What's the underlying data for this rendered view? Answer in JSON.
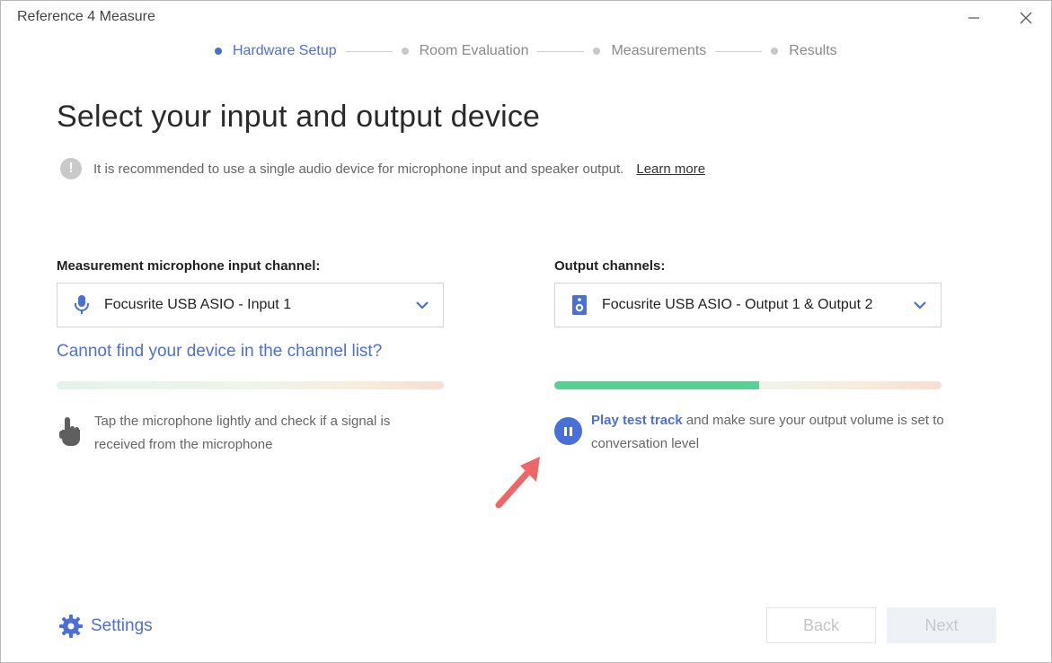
{
  "window": {
    "title": "Reference 4 Measure"
  },
  "stepper": {
    "steps": [
      {
        "label": "Hardware Setup",
        "active": true
      },
      {
        "label": "Room Evaluation",
        "active": false
      },
      {
        "label": "Measurements",
        "active": false
      },
      {
        "label": "Results",
        "active": false
      }
    ]
  },
  "page": {
    "title": "Select your input and output device",
    "notice": "It is recommended to use a single audio device for microphone input and speaker output.",
    "learn_more": "Learn more"
  },
  "input": {
    "label": "Measurement microphone input channel:",
    "selected": "Focusrite USB ASIO - Input 1",
    "icon": "microphone-icon",
    "help_link": "Cannot find your device in the channel list?",
    "level": 0,
    "hint": "Tap the microphone lightly and check if a signal is received from the microphone",
    "hint_icon": "tap-hand-icon"
  },
  "output": {
    "label": "Output channels:",
    "selected": "Focusrite USB ASIO - Output 1 & Output 2",
    "icon": "speaker-icon",
    "level": 0.53,
    "play_link": "Play test track",
    "hint_rest": " and make sure your output volume is set to conversation level",
    "play_icon": "pause-icon"
  },
  "footer": {
    "settings": "Settings",
    "back": "Back",
    "next": "Next"
  },
  "colors": {
    "accent": "#4a6fd8",
    "meter_fill": "#58cf93",
    "annotation_arrow": "#f06565"
  }
}
